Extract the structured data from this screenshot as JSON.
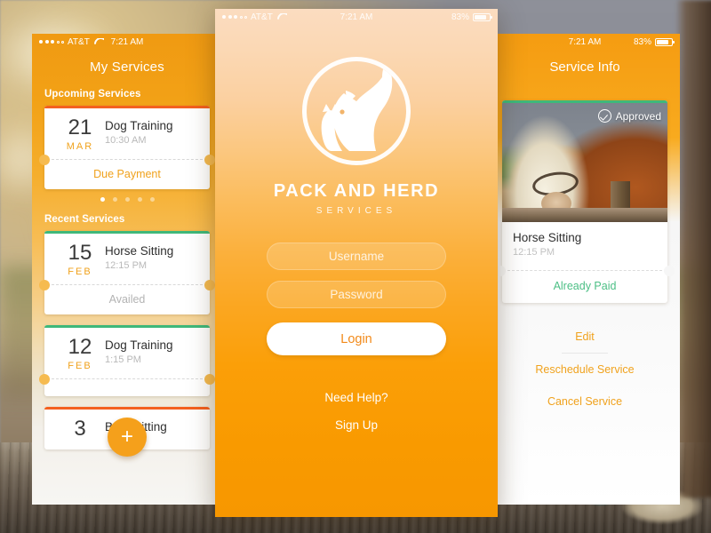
{
  "background": {
    "description": "blurred outdoor horse-farm scene with wooden rail fence",
    "sky_color": "#8e9099",
    "rail_color": "#6e6253"
  },
  "theme": {
    "orange": "#f5a01b",
    "deep_orange": "#f4601f",
    "green": "#3fb87a",
    "paid_green": "#4cbf85",
    "white": "#ffffff",
    "muted": "#b9b9b9"
  },
  "status_bar": {
    "carrier": "AT&T",
    "time": "7:21 AM",
    "battery_percent": "83%",
    "signal_filled": 3,
    "signal_empty": 2,
    "wifi_icon": "wifi-icon",
    "battery_icon": "battery-icon"
  },
  "left_phone": {
    "title": "My Services",
    "sections": [
      {
        "label": "Upcoming Services"
      },
      {
        "label": "Recent Services"
      }
    ],
    "upcoming": [
      {
        "day": "21",
        "month": "MAR",
        "name": "Dog Training",
        "time": "10:30 AM",
        "status": "Due Payment",
        "status_type": "due",
        "accent": "orange"
      }
    ],
    "pager": {
      "total": 5,
      "active_index": 0
    },
    "recent": [
      {
        "day": "15",
        "month": "FEB",
        "name": "Horse Sitting",
        "time": "12:15 PM",
        "status": "Availed",
        "status_type": "availed",
        "accent": "green"
      },
      {
        "day": "12",
        "month": "FEB",
        "name": "Dog Training",
        "time": "1:15 PM",
        "status": "",
        "status_type": "availed",
        "accent": "green"
      },
      {
        "day": "3",
        "month": "",
        "name": "Barn Sitting",
        "time": "",
        "status": "",
        "status_type": "due",
        "accent": "orange"
      }
    ],
    "fab": {
      "label": "+",
      "icon": "plus-icon"
    }
  },
  "center_phone": {
    "logo": {
      "icon": "pack-and-herd-logo-icon",
      "description": "circular badge with horse, dog and cat silhouettes"
    },
    "brand_name": "PACK AND HERD",
    "brand_tagline": "SERVICES",
    "username": {
      "value": "",
      "placeholder": "Username"
    },
    "password": {
      "value": "",
      "placeholder": "Password"
    },
    "login_button": "Login",
    "links": [
      {
        "label": "Need Help?"
      },
      {
        "label": "Sign Up"
      }
    ]
  },
  "right_phone": {
    "title": "Service Info",
    "photo": {
      "icon": "horse-photo",
      "alt": "palomino horse behind wooden rail"
    },
    "badge": {
      "label": "Approved",
      "icon": "check-circle-icon"
    },
    "service": {
      "name": "Horse Sitting",
      "time": "12:15 PM",
      "payment_status": "Already Paid"
    },
    "actions": [
      {
        "label": "Edit"
      },
      {
        "label": "Reschedule Service"
      },
      {
        "label": "Cancel Service"
      }
    ]
  }
}
